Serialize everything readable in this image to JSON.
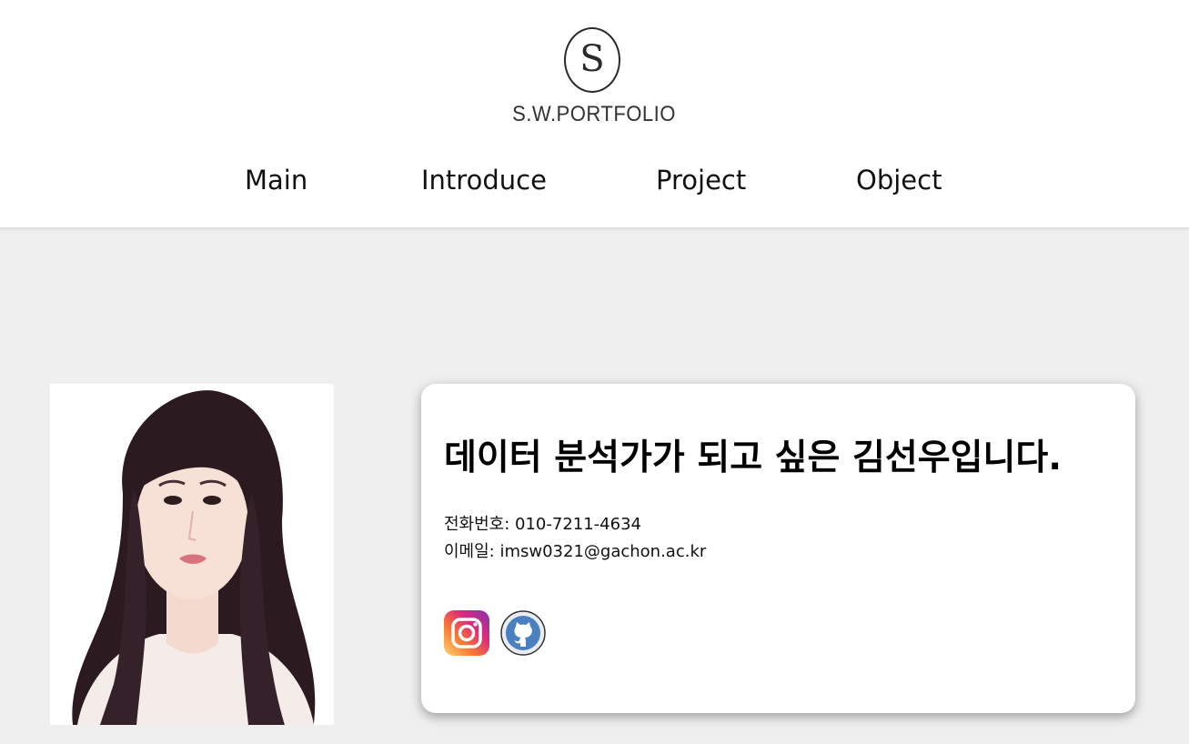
{
  "header": {
    "logo_letter": "S",
    "logo_text": "S.W.PORTFOLIO"
  },
  "nav": {
    "items": [
      {
        "label": "Main"
      },
      {
        "label": "Introduce"
      },
      {
        "label": "Project"
      },
      {
        "label": "Object"
      }
    ]
  },
  "profile": {
    "headline": "데이터 분석가가 되고 싶은 김선우입니다.",
    "phone": "전화번호: 010-7211-4634",
    "email": "이메일: imsw0321@gachon.ac.kr",
    "social": [
      {
        "icon": "instagram-icon"
      },
      {
        "icon": "github-icon"
      }
    ]
  },
  "colors": {
    "page_background": "#efefef",
    "header_background": "#ffffff",
    "card_background": "#ffffff",
    "github_blue": "#4a7fc1"
  }
}
